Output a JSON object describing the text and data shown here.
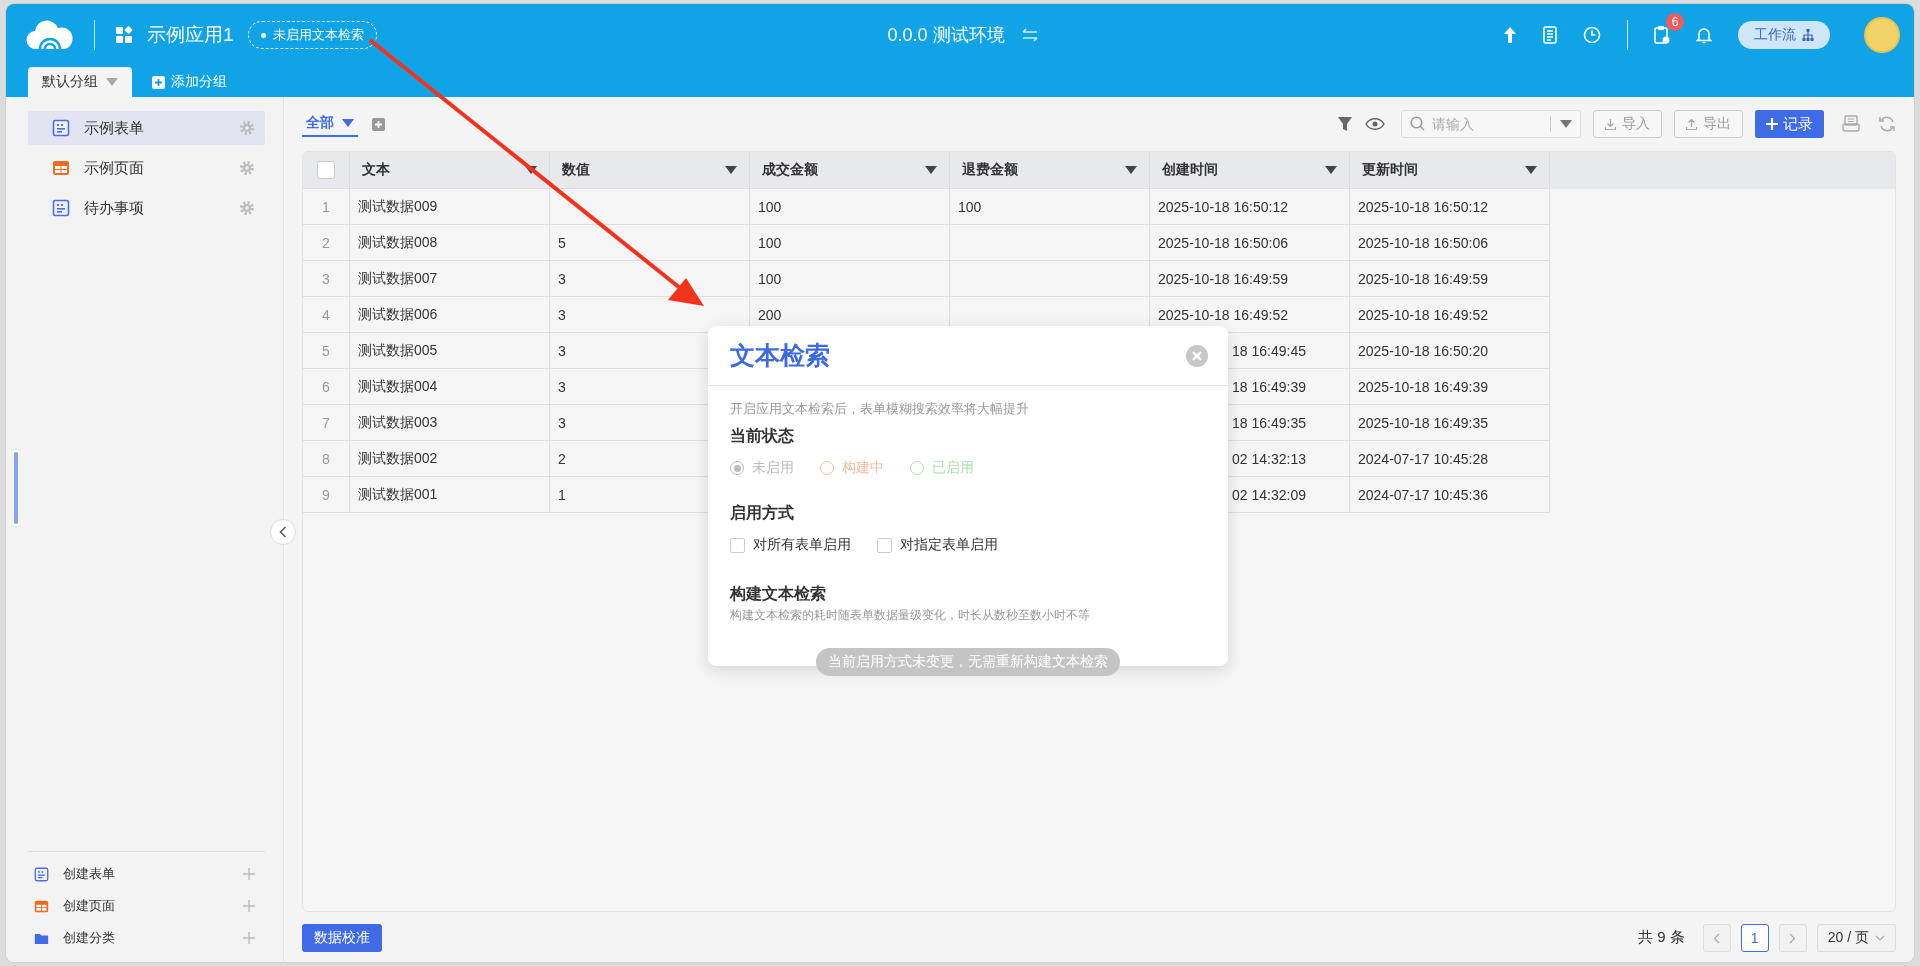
{
  "header": {
    "app_name": "示例应用1",
    "search_badge": "未启用文本检索",
    "environment": "0.0.0 测试环境",
    "notification_count": "6",
    "workflow_button": "工作流"
  },
  "group_tabs": [
    {
      "label": "默认分组",
      "selected": true
    }
  ],
  "add_group": "添加分组",
  "sidebar": {
    "items": [
      {
        "label": "示例表单",
        "kind": "form",
        "selected": true
      },
      {
        "label": "示例页面",
        "kind": "page",
        "selected": false
      },
      {
        "label": "待办事项",
        "kind": "form",
        "selected": false
      }
    ],
    "create_items": [
      {
        "label": "创建表单",
        "kind": "form"
      },
      {
        "label": "创建页面",
        "kind": "page"
      },
      {
        "label": "创建分类",
        "kind": "folder"
      }
    ]
  },
  "toolbar": {
    "views": [
      {
        "label": "全部",
        "selected": true
      }
    ],
    "search": {
      "placeholder": "请输入"
    },
    "import_button": "导入",
    "export_button": "导出",
    "add_record_button": "记录"
  },
  "table": {
    "select_all_checked": false,
    "columns": [
      "文本",
      "数值",
      "成交金额",
      "退费金额",
      "创建时间",
      "更新时间"
    ],
    "rows": [
      {
        "num": "1",
        "covered": false,
        "cells": [
          "测试数据009",
          null,
          "100",
          "100",
          "2025-10-18 16:50:12",
          "2025-10-18 16:50:12"
        ]
      },
      {
        "num": "2",
        "covered": false,
        "cells": [
          "测试数据008",
          "5",
          "100",
          null,
          "2025-10-18 16:50:06",
          "2025-10-18 16:50:06"
        ]
      },
      {
        "num": "3",
        "covered": false,
        "cells": [
          "测试数据007",
          "3",
          "100",
          null,
          "2025-10-18 16:49:59",
          "2025-10-18 16:49:59"
        ]
      },
      {
        "num": "4",
        "covered": false,
        "cells": [
          "测试数据006",
          "3",
          "200",
          null,
          "2025-10-18 16:49:52",
          "2025-10-18 16:49:52"
        ]
      },
      {
        "num": "5",
        "covered": true,
        "cells": [
          "测试数据005",
          "3",
          null,
          null,
          "18 16:49:45",
          "2025-10-18 16:50:20"
        ]
      },
      {
        "num": "6",
        "covered": true,
        "cells": [
          "测试数据004",
          "3",
          null,
          null,
          "18 16:49:39",
          "2025-10-18 16:49:39"
        ]
      },
      {
        "num": "7",
        "covered": true,
        "cells": [
          "测试数据003",
          "3",
          null,
          null,
          "18 16:49:35",
          "2025-10-18 16:49:35"
        ]
      },
      {
        "num": "8",
        "covered": true,
        "cells": [
          "测试数据002",
          "2",
          null,
          null,
          "02 14:32:13",
          "2024-07-17 10:45:28"
        ]
      },
      {
        "num": "9",
        "covered": true,
        "cells": [
          "测试数据001",
          "1",
          null,
          null,
          "02 14:32:09",
          "2024-07-17 10:45:36"
        ]
      }
    ]
  },
  "footer": {
    "calibrate_button": "数据校准",
    "total": "共 9 条",
    "pages": [
      {
        "label": "1",
        "selected": true
      }
    ],
    "page_size": "20 / 页"
  },
  "modal": {
    "title": "文本检索",
    "description": "开启应用文本检索后，表单模糊搜索效率将大幅提升",
    "status_heading": "当前状态",
    "statuses": [
      {
        "label": "未启用",
        "selected": true,
        "color": "#b8bcc4"
      },
      {
        "label": "构建中",
        "selected": false,
        "color": "#f6bc9c"
      },
      {
        "label": "已启用",
        "selected": false,
        "color": "#a9e2ad"
      }
    ],
    "mode_heading": "启用方式",
    "modes": [
      {
        "label": "对所有表单启用",
        "checked": false
      },
      {
        "label": "对指定表单启用",
        "checked": false
      }
    ],
    "build_heading": "构建文本检索",
    "build_note": "构建文本检索的耗时随表单数据量级变化，时长从数秒至数小时不等",
    "build_button": {
      "label": "当前启用方式未变更，无需重新构建文本检索",
      "disabled": true
    }
  }
}
